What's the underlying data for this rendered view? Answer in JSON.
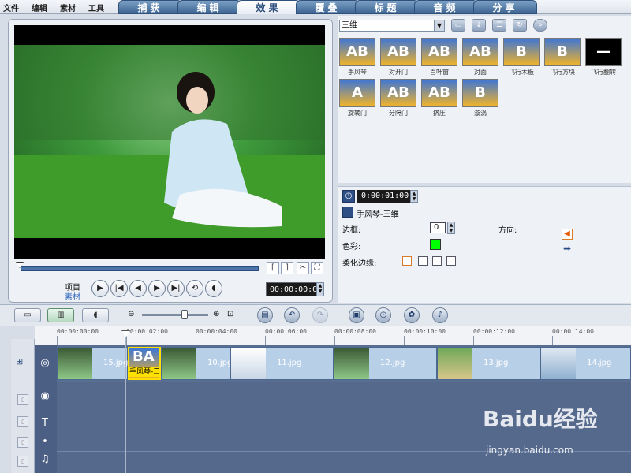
{
  "menu": [
    "文件",
    "编辑",
    "素材",
    "工具"
  ],
  "tabs": [
    {
      "label": "捕获",
      "active": false
    },
    {
      "label": "编辑",
      "active": false
    },
    {
      "label": "效果",
      "active": true
    },
    {
      "label": "覆叠",
      "active": false
    },
    {
      "label": "标题",
      "active": false
    },
    {
      "label": "音频",
      "active": false
    },
    {
      "label": "分享",
      "active": false
    }
  ],
  "preview": {
    "project_label": "项目",
    "clip_label": "素材",
    "timecode": "00:00:00:00",
    "mark_in": "[",
    "mark_out": "]"
  },
  "library": {
    "category": "三维",
    "row1": [
      {
        "name": "手风琴",
        "glyph": "AB"
      },
      {
        "name": "对开门",
        "glyph": "AB"
      },
      {
        "name": "百叶窗",
        "glyph": "AB"
      },
      {
        "name": "对面",
        "glyph": "AB"
      },
      {
        "name": "飞行木板",
        "glyph": "B"
      },
      {
        "name": "飞行方块",
        "glyph": "B"
      },
      {
        "name": "飞行翻转",
        "glyph": "—",
        "black": true
      }
    ],
    "row2": [
      {
        "name": "旋转门",
        "glyph": "A"
      },
      {
        "name": "分隔门",
        "glyph": "AB"
      },
      {
        "name": "挤压",
        "glyph": "AB"
      },
      {
        "name": "漩涡",
        "glyph": "B"
      }
    ]
  },
  "options": {
    "duration": "0:00:01:00",
    "transition_name": "手风琴-三维",
    "border_label": "边框:",
    "border_value": "0",
    "color_label": "色彩:",
    "color_value": "#00ff00",
    "soften_label": "柔化边缘:",
    "direction_label": "方向:"
  },
  "timeline": {
    "ruler": [
      "00:00:00:00",
      "00:00:02:00",
      "00:00:04:00",
      "00:00:06:00",
      "00:00:08:00",
      "00:00:10:00",
      "00:00:12:00",
      "00:00:14:00"
    ],
    "clips": [
      "15.jpg",
      "10.jpg",
      "11.jpg",
      "12.jpg",
      "13.jpg",
      "14.jpg"
    ],
    "transition": "手风琴-三维",
    "transition_glyph": "BA"
  },
  "watermark": {
    "brand": "Baidu经验",
    "url": "jingyan.baidu.com"
  },
  "colors": {
    "accent": "#3d6592",
    "track": "#5a6e92",
    "active_tab": "#ffffff"
  }
}
